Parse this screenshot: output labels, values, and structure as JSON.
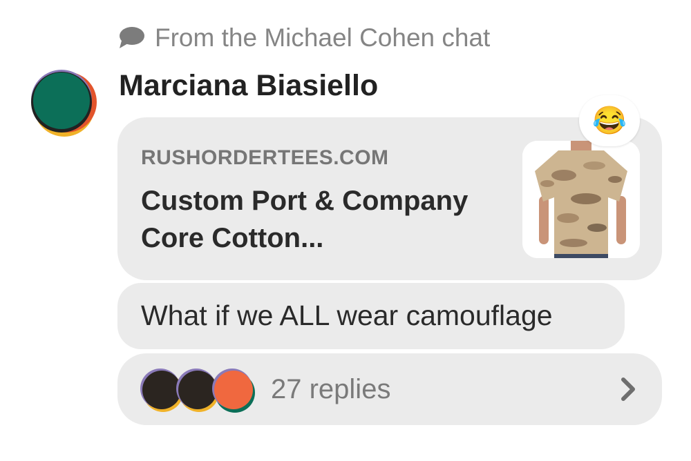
{
  "source": {
    "icon": "speech-bubble-icon",
    "label": "From the Michael Cohen chat"
  },
  "message": {
    "sender_name": "Marciana Biasiello",
    "reaction_emoji": "😂",
    "link_preview": {
      "domain": "RUSHORDERTEES.COM",
      "title": "Custom Port & Company Core Cotton..."
    },
    "text": "What if we ALL wear camouflage"
  },
  "thread": {
    "replies_label": "27 replies",
    "chevron_icon": "chevron-right-icon"
  },
  "colors": {
    "bubble": "#ebebeb",
    "meta_text": "#858585",
    "body_text": "#2a2a2a"
  }
}
